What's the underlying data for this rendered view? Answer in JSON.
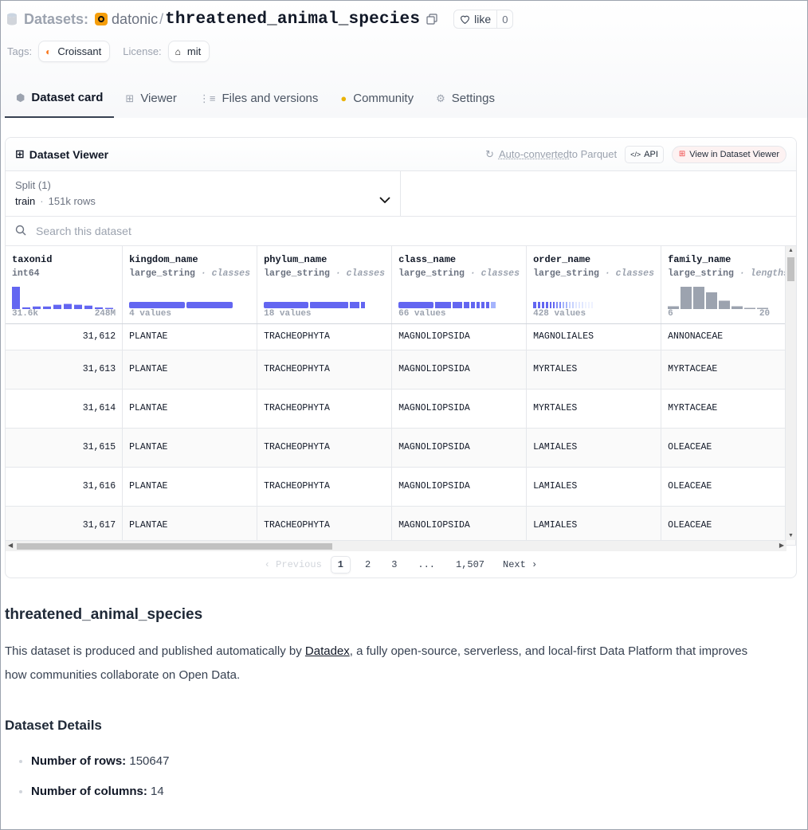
{
  "header": {
    "datasets_label": "Datasets:",
    "org": "datonic",
    "separator": "/",
    "repo": "threatened_animal_species",
    "like_label": "like",
    "like_count": "0"
  },
  "tags": {
    "tags_label": "Tags:",
    "tag": "Croissant",
    "license_label": "License:",
    "license": "mit"
  },
  "tabs": [
    {
      "label": "Dataset card",
      "icon": "cube-icon"
    },
    {
      "label": "Viewer",
      "icon": "table-icon"
    },
    {
      "label": "Files and versions",
      "icon": "files-icon"
    },
    {
      "label": "Community",
      "icon": "community-icon"
    },
    {
      "label": "Settings",
      "icon": "gear-icon"
    }
  ],
  "viewer": {
    "title": "Dataset Viewer",
    "auto_converted": "Auto-converted",
    "to_parquet": " to Parquet",
    "api_label": "API",
    "view_label": "View in Dataset Viewer",
    "split_label": "Split (1)",
    "split_name": "train",
    "split_dot": "·",
    "split_rows": "151k rows",
    "search_placeholder": "Search this dataset",
    "columns": [
      {
        "name": "taxonid",
        "type": "int64",
        "kind": "",
        "stat_left": "31.6k",
        "stat_right": "248M"
      },
      {
        "name": "kingdom_name",
        "type": "large_string",
        "kind": "classes",
        "stat_left": "4 values",
        "stat_right": ""
      },
      {
        "name": "phylum_name",
        "type": "large_string",
        "kind": "classes",
        "stat_left": "18 values",
        "stat_right": ""
      },
      {
        "name": "class_name",
        "type": "large_string",
        "kind": "classes",
        "stat_left": "66 values",
        "stat_right": ""
      },
      {
        "name": "order_name",
        "type": "large_string",
        "kind": "classes",
        "stat_left": "428 values",
        "stat_right": ""
      },
      {
        "name": "family_name",
        "type": "large_string",
        "kind": "lengths",
        "stat_left": "6",
        "stat_right": "20"
      }
    ],
    "type_sep": " · ",
    "rows": [
      [
        "31,612",
        "PLANTAE",
        "TRACHEOPHYTA",
        "MAGNOLIOPSIDA",
        "MAGNOLIALES",
        "ANNONACEAE"
      ],
      [
        "31,613",
        "PLANTAE",
        "TRACHEOPHYTA",
        "MAGNOLIOPSIDA",
        "MYRTALES",
        "MYRTACEAE"
      ],
      [
        "31,614",
        "PLANTAE",
        "TRACHEOPHYTA",
        "MAGNOLIOPSIDA",
        "MYRTALES",
        "MYRTACEAE"
      ],
      [
        "31,615",
        "PLANTAE",
        "TRACHEOPHYTA",
        "MAGNOLIOPSIDA",
        "LAMIALES",
        "OLEACEAE"
      ],
      [
        "31,616",
        "PLANTAE",
        "TRACHEOPHYTA",
        "MAGNOLIOPSIDA",
        "LAMIALES",
        "OLEACEAE"
      ],
      [
        "31,617",
        "PLANTAE",
        "TRACHEOPHYTA",
        "MAGNOLIOPSIDA",
        "LAMIALES",
        "OLEACEAE"
      ]
    ],
    "histograms": {
      "taxonid": [
        26,
        2,
        3,
        3,
        5,
        6,
        5,
        4,
        2,
        1
      ],
      "family_name": [
        1,
        8,
        8,
        6,
        3,
        1,
        0.3,
        0.3
      ]
    },
    "pager": {
      "prev": "‹ Previous",
      "pages": [
        "1",
        "2",
        "3",
        "...",
        "1,507"
      ],
      "next": "Next ›"
    }
  },
  "readme": {
    "title": "threatened_animal_species",
    "p_before": "This dataset is produced and published automatically by ",
    "link": "Datadex",
    "p_after": ", a fully open-source, serverless, and local-first Data Platform that improves how communities collaborate on Open Data.",
    "details_heading": "Dataset Details",
    "details": [
      {
        "key": "Number of rows:",
        "value": "150647"
      },
      {
        "key": "Number of columns:",
        "value": "14"
      }
    ]
  },
  "colors": {
    "accent_bar": "#6366f1",
    "hist_gray": "#9ca3af"
  }
}
